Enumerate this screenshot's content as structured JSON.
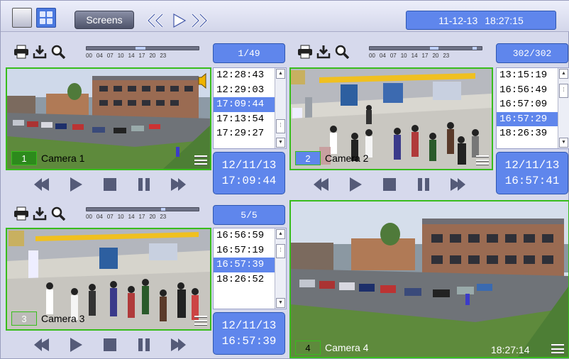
{
  "topbar": {
    "screens_label": "Screens",
    "clock_date": "11-12-13",
    "clock_time": "18:27:15"
  },
  "scale_ticks": [
    "00",
    "04",
    "07",
    "10",
    "14",
    "17",
    "20",
    "23"
  ],
  "panels": [
    {
      "camera_number": "1",
      "camera_name": "Camera 1",
      "counter": "1/49",
      "times": [
        "12:28:43",
        "12:29:03",
        "17:09:44",
        "17:13:54",
        "17:29:27"
      ],
      "selected": 2,
      "date": "12/11/13",
      "time": "17:09:44"
    },
    {
      "camera_number": "2",
      "camera_name": "Camera 2",
      "counter": "302/302",
      "times": [
        "13:15:19",
        "16:56:49",
        "16:57:09",
        "16:57:29",
        "18:26:39"
      ],
      "selected": 3,
      "date": "12/11/13",
      "time": "16:57:41"
    },
    {
      "camera_number": "3",
      "camera_name": "Camera 3",
      "counter": "5/5",
      "times": [
        "16:56:59",
        "16:57:19",
        "16:57:39",
        "18:26:52"
      ],
      "selected": 2,
      "date": "12/11/13",
      "time": "16:57:39"
    },
    {
      "camera_number": "4",
      "camera_name": "Camera 4",
      "live_time": "18:27:14"
    }
  ],
  "colors": {
    "accent": "#5f86ec",
    "frame": "#38bd1c",
    "panel_bg": "#d6d9ec"
  },
  "icons": [
    "single-layout-icon",
    "quad-layout-icon",
    "rewind-icon",
    "play-icon",
    "fast-forward-icon",
    "print-icon",
    "download-icon",
    "zoom-icon",
    "stop-icon",
    "pause-icon",
    "menu-icon",
    "speaker-icon"
  ]
}
